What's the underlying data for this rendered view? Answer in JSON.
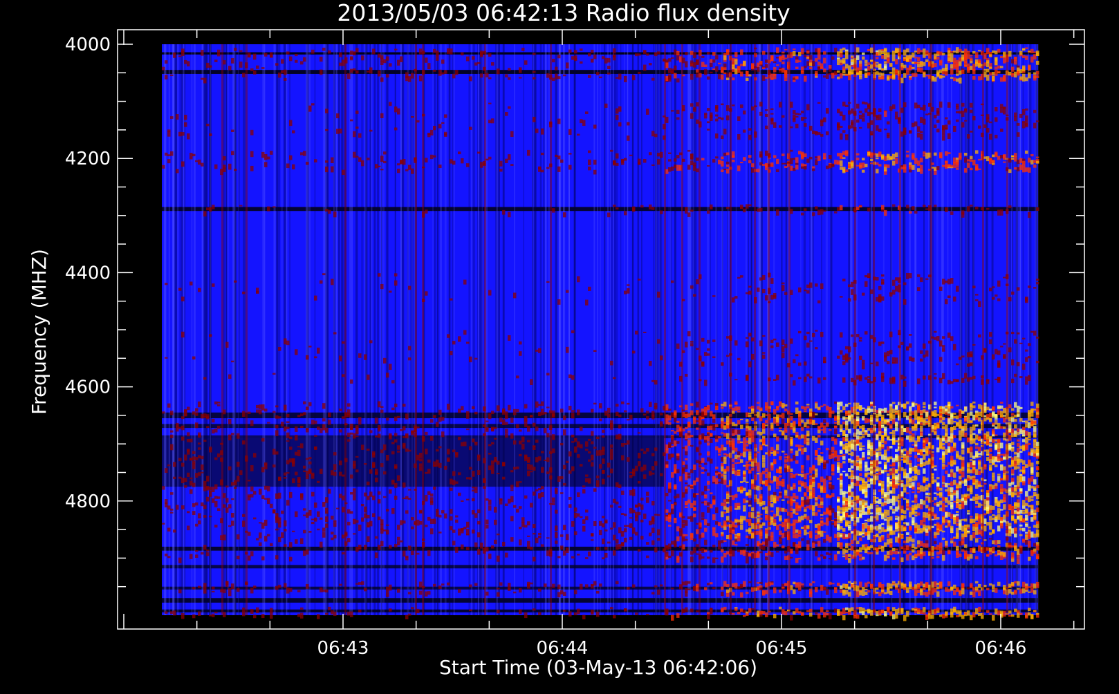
{
  "chart_data": {
    "type": "heatmap",
    "title": "2013/05/03 06:42:13 Radio flux density",
    "xlabel": "Start Time (03-May-13 06:42:06)",
    "ylabel": "Frequency (MHZ)",
    "x_axis": {
      "major_ticks": [
        {
          "label": "06:43",
          "value": 1
        },
        {
          "label": "06:44",
          "value": 2
        },
        {
          "label": "06:45",
          "value": 3
        },
        {
          "label": "06:46",
          "value": 4
        }
      ],
      "minor_ticks_per_major": 3
    },
    "y_axis": {
      "range": [
        4000,
        5000
      ],
      "inverted": true,
      "major_ticks": [
        {
          "label": "4000",
          "value": 4000
        },
        {
          "label": "4200",
          "value": 4200
        },
        {
          "label": "4400",
          "value": 4400
        },
        {
          "label": "4600",
          "value": 4600
        },
        {
          "label": "4800",
          "value": 4800
        }
      ],
      "minor_step": 50
    },
    "data_extent": {
      "time_start": "06:42:13",
      "time_end": "06:46:13",
      "freq_start": 4000,
      "freq_end": 5000
    },
    "colormap": [
      "#000000",
      "#1414ff",
      "#8b0000",
      "#ff3000",
      "#ffb000",
      "#ffff80"
    ],
    "background_color": "#000000",
    "axis_color": "#ffffff",
    "grid": false,
    "legend": "none"
  }
}
